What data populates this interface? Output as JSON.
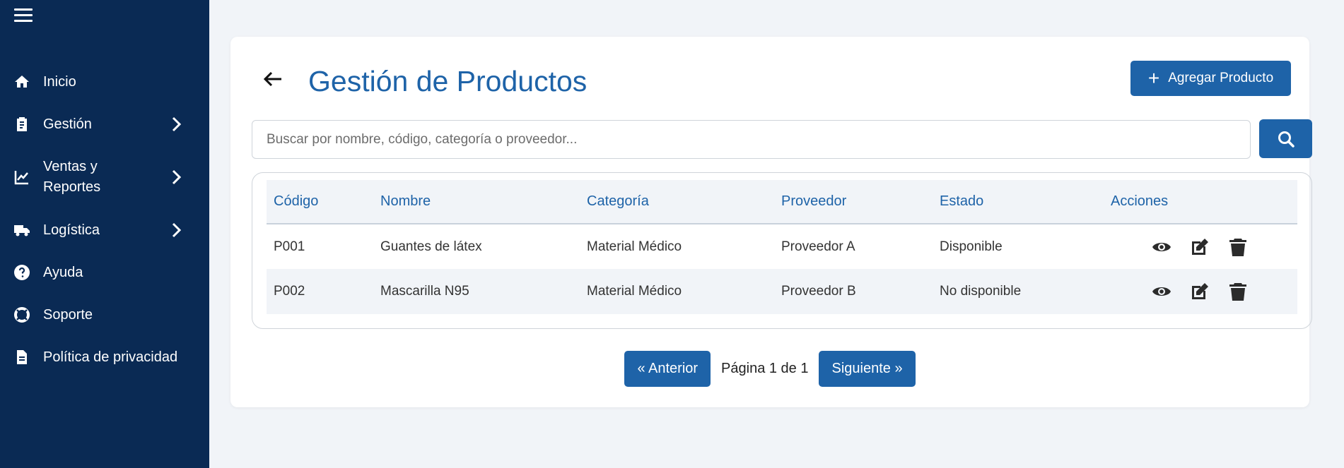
{
  "sidebar": {
    "items": [
      {
        "label": "Inicio",
        "icon": "home-icon"
      },
      {
        "label": "Gestión",
        "icon": "clipboard-icon",
        "has_submenu": true
      },
      {
        "label": "Ventas y Reportes",
        "icon": "chart-line-icon",
        "has_submenu": true
      },
      {
        "label": "Logística",
        "icon": "truck-icon",
        "has_submenu": true
      },
      {
        "label": "Ayuda",
        "icon": "question-circle-icon"
      },
      {
        "label": "Soporte",
        "icon": "life-ring-icon"
      },
      {
        "label": "Política de privacidad",
        "icon": "file-icon"
      }
    ]
  },
  "header": {
    "title": "Gestión de Productos",
    "add_button_label": "Agregar Producto"
  },
  "search": {
    "placeholder": "Buscar por nombre, código, categoría o proveedor...",
    "value": ""
  },
  "table": {
    "columns": [
      "Código",
      "Nombre",
      "Categoría",
      "Proveedor",
      "Estado",
      "Acciones"
    ],
    "rows": [
      {
        "codigo": "P001",
        "nombre": "Guantes de látex",
        "categoria": "Material Médico",
        "proveedor": "Proveedor A",
        "estado": "Disponible"
      },
      {
        "codigo": "P002",
        "nombre": "Mascarilla N95",
        "categoria": "Material Médico",
        "proveedor": "Proveedor B",
        "estado": "No disponible"
      }
    ]
  },
  "pagination": {
    "prev_label": "« Anterior",
    "info": "Página 1 de 1",
    "next_label": "Siguiente »"
  },
  "colors": {
    "sidebar_bg": "#0a2a54",
    "primary": "#1e63a8",
    "page_bg": "#f1f4f8"
  }
}
